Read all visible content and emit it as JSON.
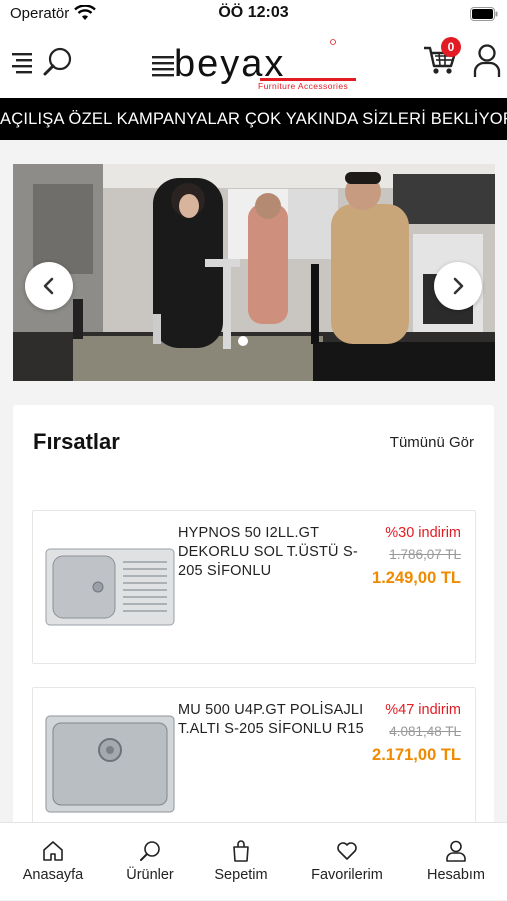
{
  "status": {
    "carrier": "Operatör",
    "time": "ÖÖ 12:03"
  },
  "header": {
    "logo_text": "beyax",
    "logo_sub": "Furniture Accessories",
    "cart_count": "0"
  },
  "announcement": "AÇILIŞA ÖZEL KAMPANYALAR ÇOK YAKINDA SİZLERİ BEKLİYOR.",
  "deals": {
    "title": "Fırsatlar",
    "see_all": "Tümünü Gör",
    "products": [
      {
        "name": "HYPNOS 50 I2LL.GT DEKORLU SOL T.ÜSTÜ S-205 SİFONLU",
        "discount": "%30 indirim",
        "old_price": "1.786,07 TL",
        "price": "1.249,00 TL"
      },
      {
        "name": "MU 500 U4P.GT POLİSAJLI T.ALTI S-205 SİFONLU R15",
        "discount": "%47 indirim",
        "old_price": "4.081,48 TL",
        "price": "2.171,00 TL"
      }
    ]
  },
  "tabs": [
    {
      "label": "Anasayfa",
      "icon": "home-icon"
    },
    {
      "label": "Ürünler",
      "icon": "search-icon"
    },
    {
      "label": "Sepetim",
      "icon": "bag-icon"
    },
    {
      "label": "Favorilerim",
      "icon": "heart-icon"
    },
    {
      "label": "Hesabım",
      "icon": "user-icon"
    }
  ],
  "colors": {
    "accent_red": "#e31b23",
    "price_orange": "#f08a00",
    "announce_bg": "#000000"
  }
}
